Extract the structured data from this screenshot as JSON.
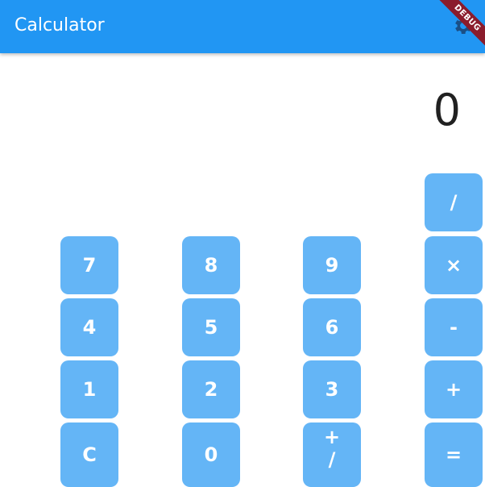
{
  "appbar": {
    "title": "Calculator",
    "color": "#2196f3",
    "icon": "gear-icon"
  },
  "debug_banner": {
    "label": "DEBUG",
    "color": "#8a1c2c"
  },
  "display": {
    "value": "0"
  },
  "keys": {
    "divide": "/",
    "seven": "7",
    "eight": "8",
    "nine": "9",
    "multiply": "×",
    "four": "4",
    "five": "5",
    "six": "6",
    "minus": "-",
    "one": "1",
    "two": "2",
    "three": "3",
    "plus": "+",
    "clear": "C",
    "zero": "0",
    "plus_minus_top": "+",
    "plus_minus_bottom": "/",
    "equals": "="
  },
  "colors": {
    "key_background": "#64b5f6",
    "key_text": "#ffffff",
    "display_text": "#212121"
  }
}
